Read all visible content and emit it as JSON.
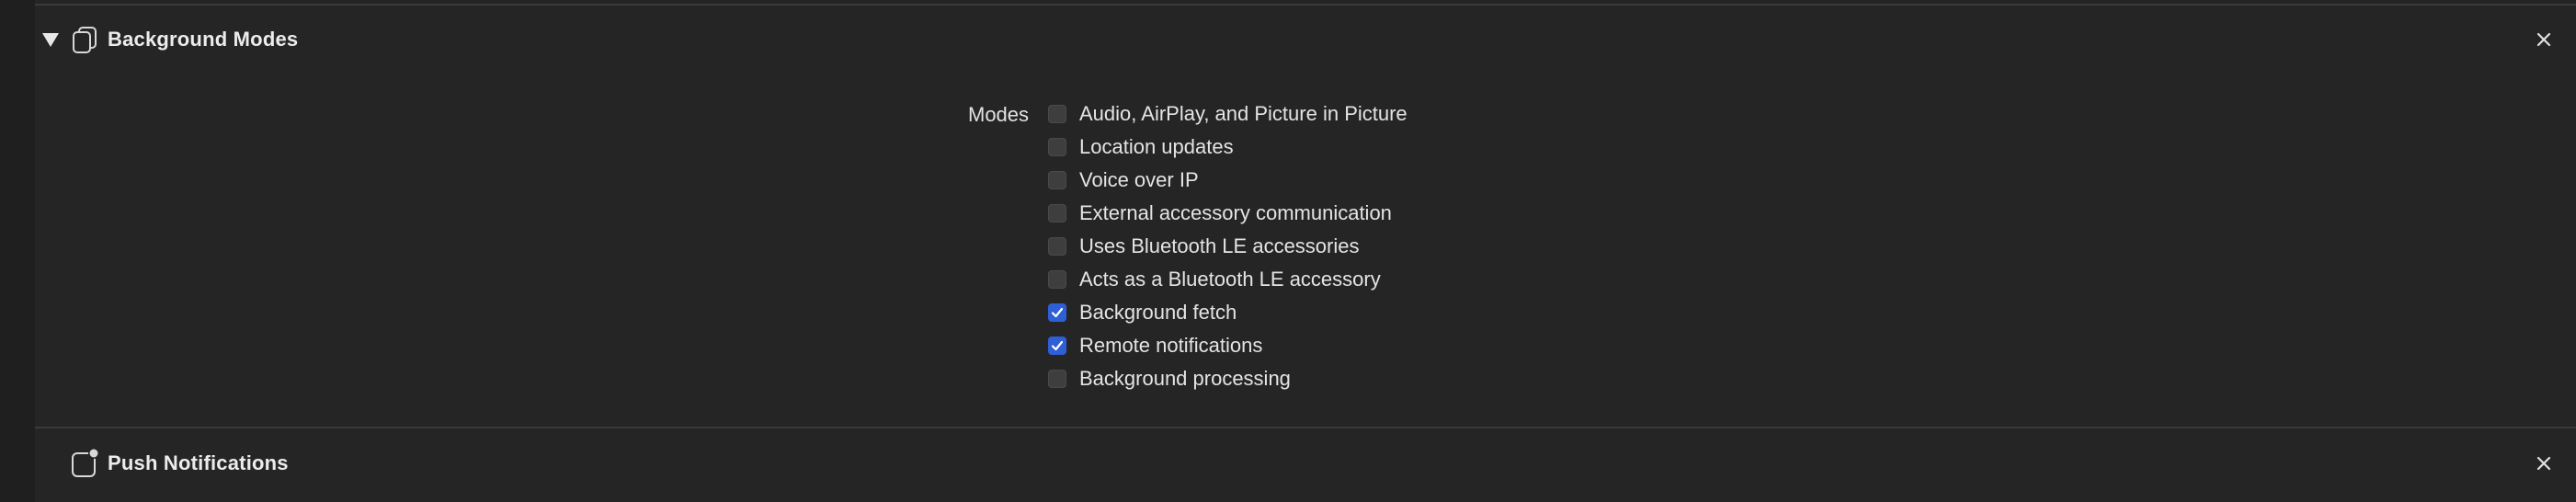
{
  "background_modes": {
    "title": "Background Modes",
    "icon": "background-modes-icon",
    "expanded": true,
    "modes_label": "Modes",
    "modes": [
      {
        "label": "Audio, AirPlay, and Picture in Picture",
        "checked": false
      },
      {
        "label": "Location updates",
        "checked": false
      },
      {
        "label": "Voice over IP",
        "checked": false
      },
      {
        "label": "External accessory communication",
        "checked": false
      },
      {
        "label": "Uses Bluetooth LE accessories",
        "checked": false
      },
      {
        "label": "Acts as a Bluetooth LE accessory",
        "checked": false
      },
      {
        "label": "Background fetch",
        "checked": true
      },
      {
        "label": "Remote notifications",
        "checked": true
      },
      {
        "label": "Background processing",
        "checked": false
      }
    ]
  },
  "push_notifications": {
    "title": "Push Notifications",
    "icon": "push-notifications-icon"
  },
  "colors": {
    "checkbox_checked": "#2f5fd6",
    "checkbox_unchecked": "#3e3e3e",
    "panel_background": "#252525"
  }
}
